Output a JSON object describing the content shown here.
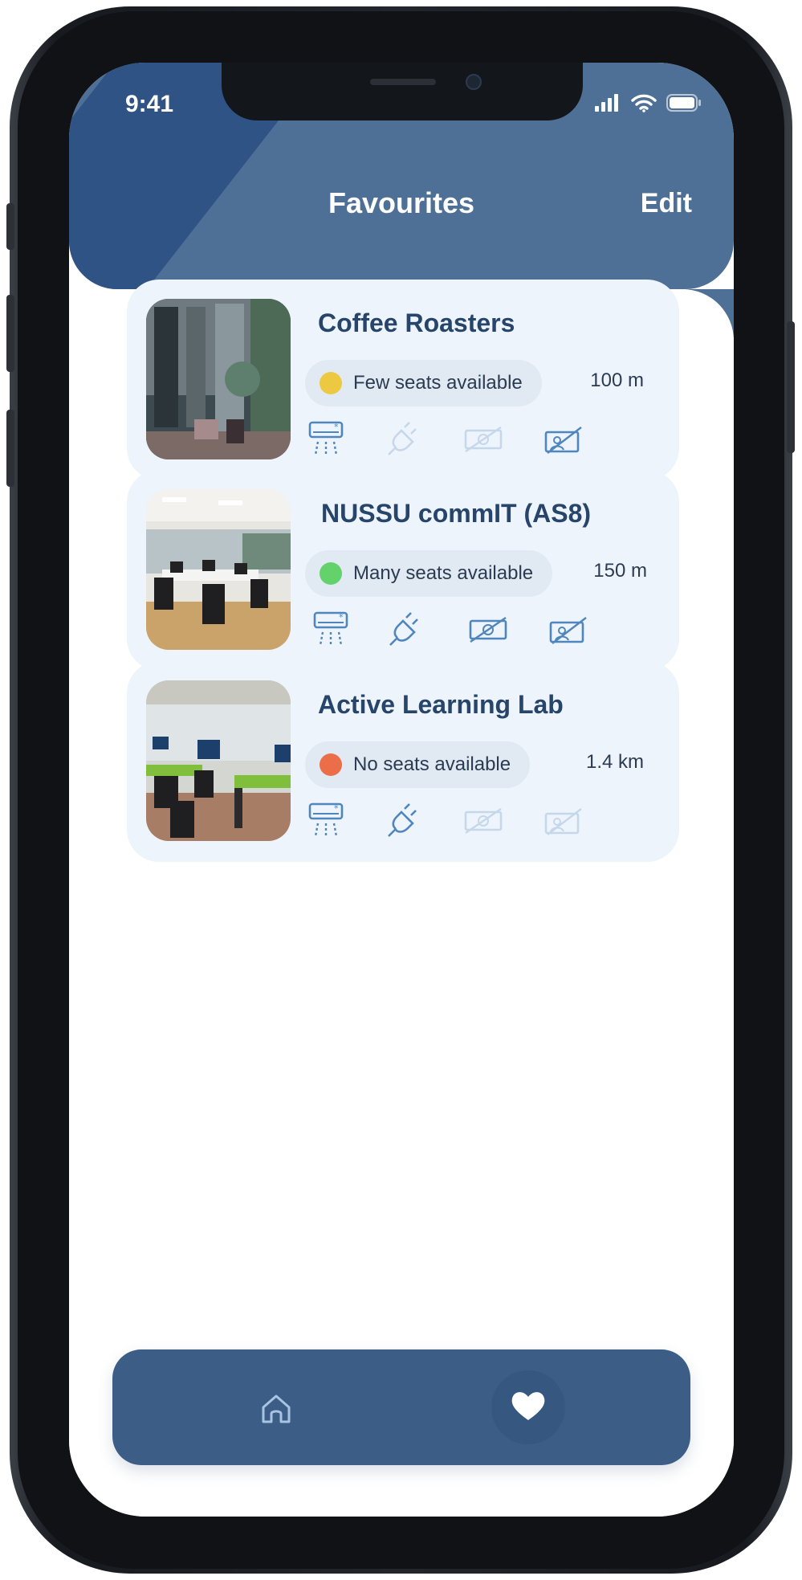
{
  "status_bar": {
    "time": "9:41"
  },
  "header": {
    "title": "Favourites",
    "edit_label": "Edit"
  },
  "favourites": [
    {
      "name": "Coffee Roasters",
      "seat_status": "Few seats available",
      "seat_color": "#ecc940",
      "distance": "100 m",
      "amenities": {
        "aircon": true,
        "power": false,
        "payment": false,
        "discussion": true
      }
    },
    {
      "name": "NUSSU commIT (AS8)",
      "seat_status": "Many seats available",
      "seat_color": "#63d26b",
      "distance": "150 m",
      "amenities": {
        "aircon": true,
        "power": true,
        "payment": true,
        "discussion": true
      }
    },
    {
      "name": "Active Learning Lab",
      "seat_status": "No seats available",
      "seat_color": "#ec6e48",
      "distance": "1.4 km",
      "amenities": {
        "aircon": true,
        "power": true,
        "payment": false,
        "discussion": false
      }
    }
  ],
  "bottom_nav": {
    "items": [
      "home-icon",
      "heart-icon"
    ],
    "active": "heart-icon"
  },
  "colors": {
    "header": "#4f7096",
    "nav": "#3b5d86",
    "card": "#eef4fb",
    "title": "#27456b",
    "icon": "#4f86bd"
  }
}
